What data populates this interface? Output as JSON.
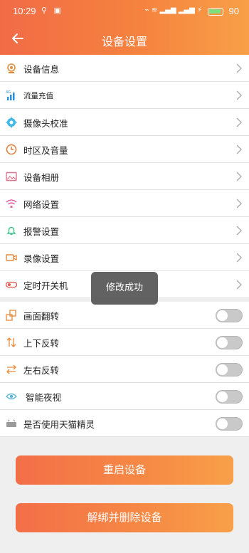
{
  "status_bar": {
    "time": "10:29",
    "battery": "90"
  },
  "header": {
    "title": "设备设置"
  },
  "menu_items": [
    {
      "label": "设备信息",
      "icon": "device-info-icon"
    },
    {
      "label": "流量充值",
      "icon": "signal-4g-icon"
    },
    {
      "label": "摄像头校准",
      "icon": "camera-calibrate-icon"
    },
    {
      "label": "时区及音量",
      "icon": "clock-icon"
    },
    {
      "label": "设备相册",
      "icon": "album-icon"
    },
    {
      "label": "网络设置",
      "icon": "wifi-icon"
    },
    {
      "label": "报警设置",
      "icon": "bell-icon"
    },
    {
      "label": "录像设置",
      "icon": "video-icon"
    },
    {
      "label": "定时开关机",
      "icon": "power-toggle-icon"
    }
  ],
  "toggle_items": [
    {
      "label": "画面翻转",
      "icon": "flip-screen-icon",
      "on": false
    },
    {
      "label": "上下反转",
      "icon": "vertical-flip-icon",
      "on": false
    },
    {
      "label": "左右反转",
      "icon": "horizontal-flip-icon",
      "on": false
    },
    {
      "label": "智能夜视",
      "icon": "eye-icon",
      "on": false
    },
    {
      "label": "是否使用天猫精灵",
      "icon": "speaker-icon",
      "on": false
    }
  ],
  "toast": {
    "text": "修改成功"
  },
  "buttons": {
    "restart": "重启设备",
    "unbind": "解绑并删除设备"
  },
  "colors": {
    "accent": "#f5823f",
    "toggle_off": "#c9c9c9"
  }
}
